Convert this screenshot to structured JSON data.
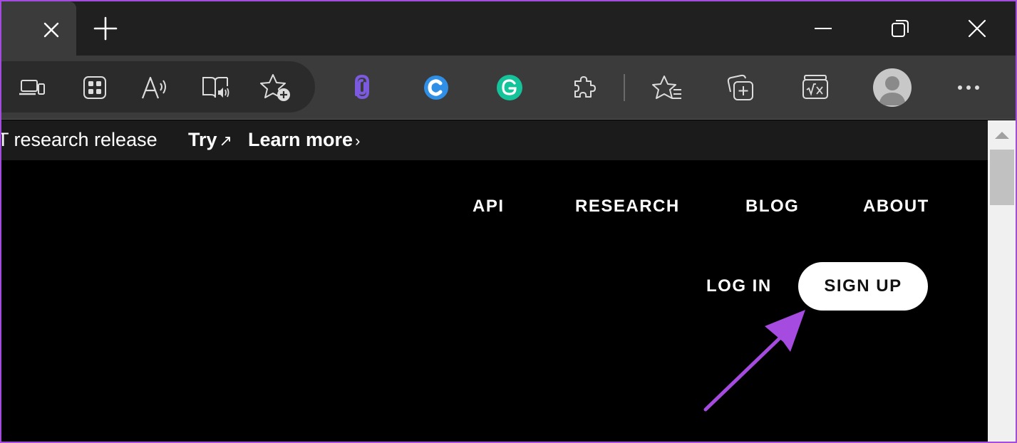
{
  "browser": {
    "tab": {
      "close_icon": "close-icon"
    },
    "new_tab_icon": "plus-icon",
    "window_controls": [
      "minimize-icon",
      "restore-icon",
      "close-icon"
    ],
    "toolbar_icons": [
      "devices-icon",
      "apps-grid-icon",
      "read-aloud-icon",
      "immersive-reader-icon",
      "add-favorite-icon",
      "paperclip-extension-icon",
      "c-extension-icon",
      "grammarly-extension-icon",
      "extensions-puzzle-icon",
      "favorites-icon",
      "collections-icon",
      "math-solver-icon",
      "profile-avatar-icon",
      "more-icon"
    ],
    "more_label": "···"
  },
  "banner": {
    "text": "T research release",
    "try_label": "Try",
    "try_arrow": "↗",
    "learn_more_label": "Learn more",
    "learn_more_arrow": "›"
  },
  "nav": {
    "items": [
      "API",
      "RESEARCH",
      "BLOG",
      "ABOUT"
    ],
    "login_label": "LOG IN",
    "signup_label": "SIGN UP"
  },
  "annotation": {
    "color": "#a64be0",
    "icon": "arrow-pointer-icon"
  },
  "colors": {
    "page_bg": "#000000",
    "titlebar_bg": "#202020",
    "toolbar_bg": "#3b3b3b",
    "banner_bg": "#1b1b1b",
    "extension_purple": "#7b5ae0",
    "extension_blue": "#2f8fe6",
    "grammarly_green": "#15c39a"
  }
}
